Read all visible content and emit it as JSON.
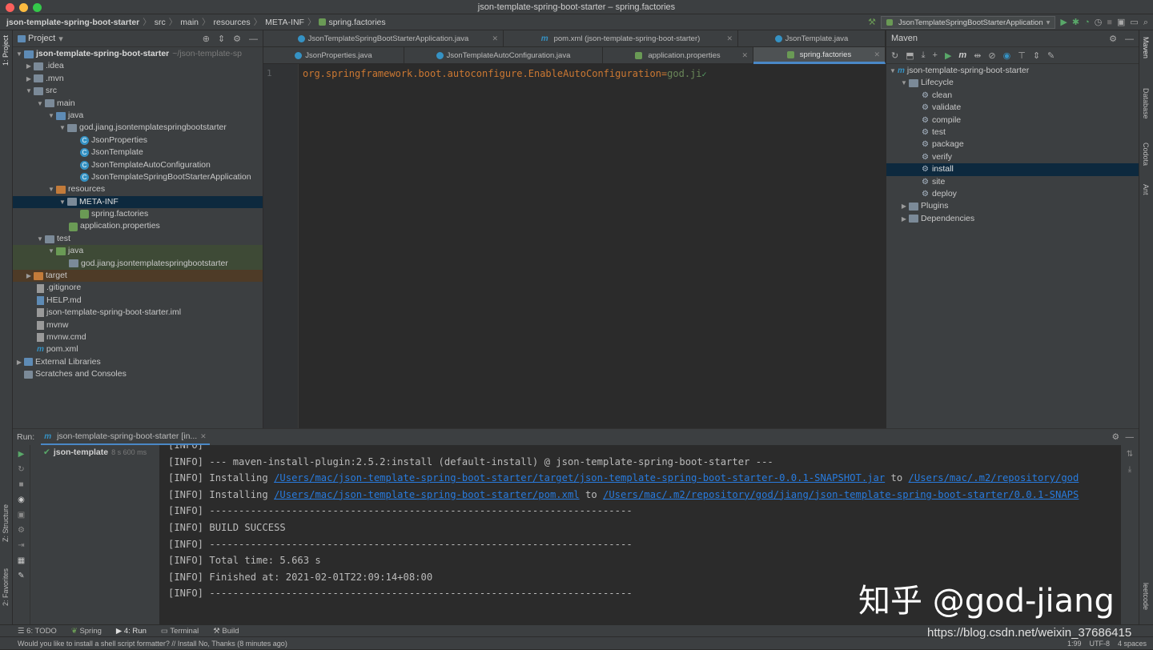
{
  "window": {
    "title": "json-template-spring-boot-starter – spring.factories"
  },
  "navbar": {
    "crumbs": [
      "json-template-spring-boot-starter",
      "src",
      "main",
      "resources",
      "META-INF",
      "spring.factories"
    ],
    "run_config": "JsonTemplateSpringBootStarterApplication"
  },
  "left_strip": {
    "project": "1: Project",
    "structure": "Z: Structure",
    "favorites": "2: Favorites"
  },
  "right_strip": {
    "maven": "Maven",
    "database": "Database",
    "codota": "Codota",
    "ant": "Ant",
    "leetcode": "leetcode"
  },
  "project": {
    "title": "Project",
    "root": {
      "name": "json-template-spring-boot-starter",
      "path": "~/json-template-sp"
    },
    "items": [
      {
        "label": ".idea"
      },
      {
        "label": ".mvn"
      },
      {
        "label": "src"
      },
      {
        "label": "main"
      },
      {
        "label": "java"
      },
      {
        "label": "god.jiang.jsontemplatespringbootstarter"
      },
      {
        "label": "JsonProperties"
      },
      {
        "label": "JsonTemplate"
      },
      {
        "label": "JsonTemplateAutoConfiguration"
      },
      {
        "label": "JsonTemplateSpringBootStarterApplication"
      },
      {
        "label": "resources"
      },
      {
        "label": "META-INF"
      },
      {
        "label": "spring.factories"
      },
      {
        "label": "application.properties"
      },
      {
        "label": "test"
      },
      {
        "label": "java"
      },
      {
        "label": "god.jiang.jsontemplatespringbootstarter"
      },
      {
        "label": "target"
      },
      {
        "label": ".gitignore"
      },
      {
        "label": "HELP.md"
      },
      {
        "label": "json-template-spring-boot-starter.iml"
      },
      {
        "label": "mvnw"
      },
      {
        "label": "mvnw.cmd"
      },
      {
        "label": "pom.xml"
      },
      {
        "label": "External Libraries"
      },
      {
        "label": "Scratches and Consoles"
      }
    ]
  },
  "editor": {
    "tabs_row1": [
      "JsonTemplateSpringBootStarterApplication.java",
      "pom.xml (json-template-spring-boot-starter)",
      "JsonTemplate.java"
    ],
    "tabs_row2": [
      "JsonProperties.java",
      "JsonTemplateAutoConfiguration.java",
      "application.properties",
      "spring.factories"
    ],
    "line_number": "1",
    "code_key": "org.springframework.boot.autoconfigure.EnableAutoConfiguration=",
    "code_value": "god.ji"
  },
  "maven": {
    "title": "Maven",
    "root": "json-template-spring-boot-starter",
    "lifecycle": "Lifecycle",
    "goals": [
      "clean",
      "validate",
      "compile",
      "test",
      "package",
      "verify",
      "install",
      "site",
      "deploy"
    ],
    "plugins": "Plugins",
    "dependencies": "Dependencies"
  },
  "run": {
    "label": "Run:",
    "tab": "json-template-spring-boot-starter [in...",
    "tree_item": "json-template",
    "tree_time": "8 s 600 ms",
    "lines": [
      {
        "text": "[INFO]"
      },
      {
        "text": "[INFO] --- maven-install-plugin:2.5.2:install (default-install) @ json-template-spring-boot-starter ---"
      },
      {
        "pre": "[INFO] Installing ",
        "link1": "/Users/mac/json-template-spring-boot-starter/target/json-template-spring-boot-starter-0.0.1-SNAPSHOT.jar",
        "mid": " to ",
        "link2": "/Users/mac/.m2/repository/god"
      },
      {
        "pre": "[INFO] Installing ",
        "link1": "/Users/mac/json-template-spring-boot-starter/pom.xml",
        "mid": " to ",
        "link2": "/Users/mac/.m2/repository/god/jiang/json-template-spring-boot-starter/0.0.1-SNAPS"
      },
      {
        "text": "[INFO] ------------------------------------------------------------------------"
      },
      {
        "text": "[INFO] BUILD SUCCESS"
      },
      {
        "text": "[INFO] ------------------------------------------------------------------------"
      },
      {
        "text": "[INFO] Total time:  5.663 s"
      },
      {
        "text": "[INFO] Finished at: 2021-02-01T22:09:14+08:00"
      },
      {
        "text": "[INFO] ------------------------------------------------------------------------"
      }
    ]
  },
  "bottom_tabs": [
    "6: TODO",
    "Spring",
    "4: Run",
    "Terminal",
    "Build"
  ],
  "status": {
    "message": "Would you like to install a shell script formatter? // Install   No, Thanks (8 minutes ago)",
    "position": "1:99",
    "encoding": "UTF-8",
    "indent": "4 spaces"
  },
  "watermark": {
    "text": "知乎 @god-jiang",
    "url": "https://blog.csdn.net/weixin_37686415"
  },
  "colors": {
    "selection": "#0d293e",
    "accent": "#4a88c7",
    "link": "#287bde",
    "keyword": "#cc7832",
    "string": "#6a8759"
  }
}
